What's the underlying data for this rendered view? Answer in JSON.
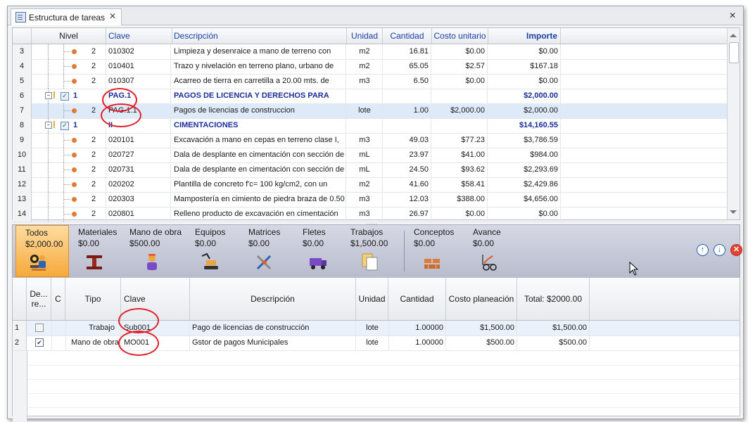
{
  "tab": {
    "title": "Estructura de tareas",
    "close": "✕"
  },
  "window": {
    "close": "✕"
  },
  "top_grid": {
    "headers": [
      "Nivel",
      "Clave",
      "Descripción",
      "Unidad",
      "Cantidad",
      "Costo unitario",
      "Importe"
    ],
    "rows": [
      {
        "num": "3",
        "nivel": "2",
        "clave": "010302",
        "desc": "Limpieza y desenraice a mano de terreno con",
        "unidad": "m2",
        "cantidad": "16.81",
        "costo": "$0.00",
        "importe": "$0.00"
      },
      {
        "num": "4",
        "nivel": "2",
        "clave": "010401",
        "desc": "Trazo y nivelación en terreno plano, urbano de",
        "unidad": "m2",
        "cantidad": "65.05",
        "costo": "$2.57",
        "importe": "$167.18"
      },
      {
        "num": "5",
        "nivel": "2",
        "clave": "010307",
        "desc": "Acarreo de tierra en carretilla a 20.00 mts. de",
        "unidad": "m3",
        "cantidad": "6.50",
        "costo": "$0.00",
        "importe": "$0.00"
      },
      {
        "num": "6",
        "nivel": "1",
        "clave": "PAG.1",
        "desc": "PAGOS DE LICENCIA Y DERECHOS PARA",
        "unidad": "",
        "cantidad": "",
        "costo": "",
        "importe": "$2,000.00"
      },
      {
        "num": "7",
        "nivel": "2",
        "clave": "PAG.1.1",
        "desc": "Pagos de licencias de construccion",
        "unidad": "lote",
        "cantidad": "1.00",
        "costo": "$2,000.00",
        "importe": "$2,000.00"
      },
      {
        "num": "8",
        "nivel": "1",
        "clave": "II",
        "desc": "CIMENTACIONES",
        "unidad": "",
        "cantidad": "",
        "costo": "",
        "importe": "$14,160.55"
      },
      {
        "num": "9",
        "nivel": "2",
        "clave": "020101",
        "desc": "Excavación a mano en cepas en terreno clase I,",
        "unidad": "m3",
        "cantidad": "49.03",
        "costo": "$77.23",
        "importe": "$3,786.59"
      },
      {
        "num": "10",
        "nivel": "2",
        "clave": "020727",
        "desc": "Dala de desplante en cimentación con sección de",
        "unidad": "mL",
        "cantidad": "23.97",
        "costo": "$41.00",
        "importe": "$984.00"
      },
      {
        "num": "11",
        "nivel": "2",
        "clave": "020731",
        "desc": "Dala de desplante en cimentación con sección de",
        "unidad": "mL",
        "cantidad": "24.50",
        "costo": "$93.62",
        "importe": "$2,293.69"
      },
      {
        "num": "12",
        "nivel": "2",
        "clave": "020202",
        "desc": "Plantilla de concreto f'c= 100 kg/cm2, con un",
        "unidad": "m2",
        "cantidad": "41.60",
        "costo": "$58.41",
        "importe": "$2,429.86"
      },
      {
        "num": "13",
        "nivel": "2",
        "clave": "020303",
        "desc": "Mampostería en cimiento de piedra braza de 0.50",
        "unidad": "m3",
        "cantidad": "12.03",
        "costo": "$388.00",
        "importe": "$4,656.00"
      },
      {
        "num": "14",
        "nivel": "2",
        "clave": "020801",
        "desc": "Relleno producto de excavación en cimentación",
        "unidad": "m3",
        "cantidad": "26.97",
        "costo": "$0.00",
        "importe": "$0.00"
      }
    ]
  },
  "ribbon": {
    "todos": {
      "label": "Todos",
      "value": "$2,000.00"
    },
    "materiales": {
      "label": "Materiales",
      "value": "$0.00"
    },
    "mano_obra": {
      "label": "Mano de obra",
      "value": "$500.00"
    },
    "equipos": {
      "label": "Equipos",
      "value": "$0.00"
    },
    "matrices": {
      "label": "Matrices",
      "value": "$0.00"
    },
    "fletes": {
      "label": "Fletes",
      "value": "$0.00"
    },
    "trabajos": {
      "label": "Trabajos",
      "value": "$1,500.00"
    },
    "conceptos": {
      "label": "Conceptos",
      "value": "$0.00"
    },
    "avance": {
      "label": "Avance",
      "value": "$0.00"
    },
    "nav_up": "↑",
    "nav_down": "↓",
    "nav_delete": "✕"
  },
  "bottom_grid": {
    "headers": {
      "de": "De... re...",
      "c": "C",
      "tipo": "Tipo",
      "clave": "Clave",
      "descripcion": "Descripción",
      "unidad": "Unidad",
      "cantidad": "Cantidad",
      "costo": "Costo planeación",
      "total": "Total: $2000.00"
    },
    "rows": [
      {
        "num": "1",
        "checked": false,
        "tipo": "Trabajo",
        "clave": "Sub001",
        "desc": "Pago de licencias de construcción",
        "unidad": "lote",
        "cantidad": "1.00000",
        "costo": "$1,500.00",
        "total": "$1,500.00"
      },
      {
        "num": "2",
        "checked": true,
        "tipo": "Mano de obra",
        "clave": "MO001",
        "desc": "Gstor de pagos Municipales",
        "unidad": "lote",
        "cantidad": "1.00000",
        "costo": "$500.00",
        "total": "$500.00"
      }
    ]
  },
  "colors": {
    "accent_blue": "#1b3ea6",
    "annotation_red": "#e0202a",
    "active_orange": "#f7a93a"
  }
}
